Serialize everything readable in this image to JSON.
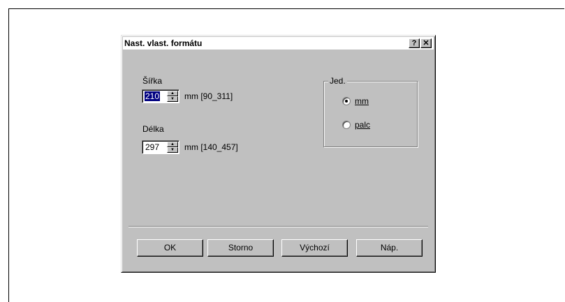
{
  "dialog": {
    "title": "Nast. vlast. formátu",
    "help_glyph": "?",
    "close_glyph": "✕"
  },
  "width": {
    "label": "Šířka",
    "value": "210",
    "range": "mm [90_311]"
  },
  "length": {
    "label": "Délka",
    "value": "297",
    "range": "mm [140_457]"
  },
  "units": {
    "group_label": "Jed.",
    "options": [
      {
        "label": "mm",
        "selected": true
      },
      {
        "label": "palc",
        "selected": false
      }
    ]
  },
  "buttons": {
    "ok": "OK",
    "cancel": "Storno",
    "default": "Výchozí",
    "help": "Náp."
  }
}
